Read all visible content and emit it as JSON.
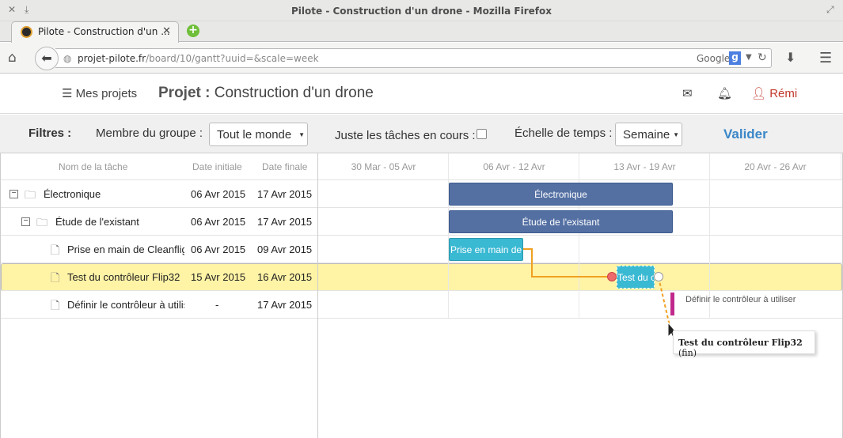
{
  "browser": {
    "window_title": "Pilote - Construction d'un drone - Mozilla Firefox",
    "tab_title": "Pilote - Construction d'un ...",
    "url_domain": "projet-pilote.fr",
    "url_path": "/board/10/gantt?uuid=&scale=week",
    "search_engine": "Google"
  },
  "header": {
    "projects_link": "Mes projets",
    "project_label": "Projet :",
    "project_name": "Construction d'un drone",
    "user_name": "Rémi"
  },
  "filters": {
    "label": "Filtres :",
    "member_label": "Membre du groupe :",
    "member_value": "Tout le monde",
    "current_tasks_label": "Juste les tâches en cours :",
    "current_tasks_checked": false,
    "scale_label": "Échelle de temps :",
    "scale_value": "Semaine",
    "submit_label": "Valider"
  },
  "grid": {
    "headers": {
      "name": "Nom de la tâche",
      "start": "Date initiale",
      "end": "Date finale"
    },
    "weeks": [
      "30 Mar - 05 Avr",
      "06 Avr - 12 Avr",
      "13 Avr - 19 Avr",
      "20 Avr - 26 Avr"
    ],
    "rows": [
      {
        "name": "Électronique",
        "start": "06 Avr 2015",
        "end": "17 Avr 2015",
        "toggle": "−"
      },
      {
        "name": "Étude de l'existant",
        "start": "06 Avr 2015",
        "end": "17 Avr 2015",
        "toggle": "−"
      },
      {
        "name": "Prise en main de Cleanflight",
        "start": "06 Avr 2015",
        "end": "09 Avr 2015"
      },
      {
        "name": "Test du contrôleur Flip32",
        "start": "15 Avr 2015",
        "end": "16 Avr 2015"
      },
      {
        "name": "Définir le contrôleur à utiliser",
        "start": "-",
        "end": "17 Avr 2015"
      }
    ]
  },
  "bars": {
    "electronique": "Électronique",
    "etude": "Étude de l'existant",
    "prise": "Prise en main de",
    "test": "Test du c"
  },
  "milestone_label": "Définir le contrôleur à utiliser",
  "tooltip": {
    "task": "Test du contrôleur Flip32",
    "suffix": "(fin)"
  },
  "colors": {
    "accent": "#3b87c8",
    "project_bar": "#5470a3",
    "task_bar": "#3ab9d3",
    "selected_row": "#fff3a6",
    "milestone": "#c0298b",
    "link": "#f0a020"
  }
}
